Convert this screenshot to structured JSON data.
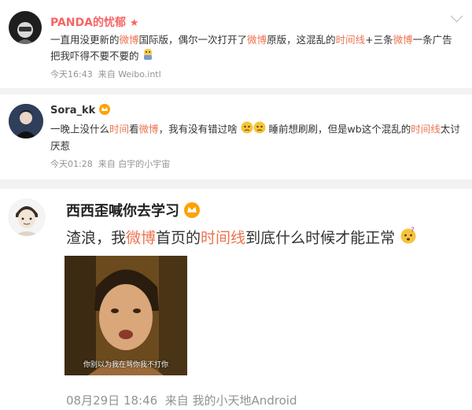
{
  "posts": [
    {
      "username": "PANDA的忧郁",
      "badge": "star",
      "segments": [
        {
          "t": "一直用没更新的",
          "hl": false
        },
        {
          "t": "微博",
          "hl": true
        },
        {
          "t": "国际版，偶尔一次打开了",
          "hl": false
        },
        {
          "t": "微博",
          "hl": true
        },
        {
          "t": "原版，这混乱的",
          "hl": false
        },
        {
          "t": "时间线",
          "hl": true
        },
        {
          "t": "+三条",
          "hl": false
        },
        {
          "t": "微博",
          "hl": true
        },
        {
          "t": "一条广告",
          "hl": false
        },
        {
          "t": "把我吓得不要不要的",
          "hl": false
        }
      ],
      "time": "今天16:43",
      "source": "来自 Weibo.intl"
    },
    {
      "username": "Sora_kk",
      "badge": "crown",
      "segments": [
        {
          "t": "一晚上没什么",
          "hl": false
        },
        {
          "t": "时间",
          "hl": true
        },
        {
          "t": "看",
          "hl": false
        },
        {
          "t": "微博",
          "hl": true
        },
        {
          "t": "，我有没有错过啥",
          "hl": false
        },
        {
          "t": "睡前想刷刷，但是wb这个混乱的",
          "hl": false
        },
        {
          "t": "时间线",
          "hl": true
        },
        {
          "t": "太讨厌惹",
          "hl": false
        }
      ],
      "time": "今天01:28",
      "source": "来自 白宇的小宇宙"
    },
    {
      "username": "西西歪喊你去学习",
      "badge": "crown",
      "segments": [
        {
          "t": "渣浪，我",
          "hl": false
        },
        {
          "t": "微博",
          "hl": true
        },
        {
          "t": "首页的",
          "hl": false
        },
        {
          "t": "时间线",
          "hl": true
        },
        {
          "t": "到底什么时候才能正常",
          "hl": false
        }
      ],
      "image_caption": "你别以为我在骂你我不打你",
      "time": "08月29日 18:46",
      "source": "来自 我的小天地Android"
    }
  ],
  "colors": {
    "highlight": "#eb7350",
    "username_red": "#f86464",
    "meta": "#939393",
    "badge": "#ffa200"
  },
  "icons": [
    "chevron-down-icon",
    "star-badge-icon",
    "crown-badge-icon",
    "worried-emoji-icon",
    "thinking-emoji-icon"
  ]
}
